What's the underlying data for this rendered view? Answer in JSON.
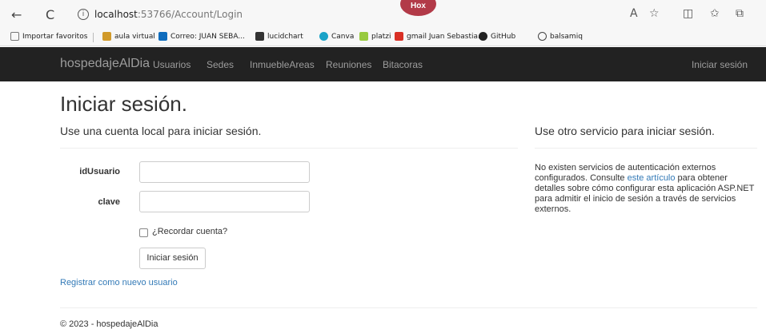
{
  "browser": {
    "back_glyph": "←",
    "reload_glyph": "C",
    "info_glyph": "i",
    "url_host": "localhost",
    "url_rest": ":53766/Account/Login",
    "profile_label": "Hox",
    "reader_glyph": "A",
    "star_glyph": "☆",
    "split_glyph": "◫",
    "favorites_glyph": "✩",
    "collections_glyph": "⧉",
    "bookmarks": [
      {
        "label": "Importar favoritos",
        "icon": "import-icon",
        "color": "#777777"
      },
      {
        "label": "aula virtual",
        "icon": "bookmark-icon",
        "color": "#d19a2a"
      },
      {
        "label": "Correo: JUAN SEBA...",
        "icon": "outlook-icon",
        "color": "#0f6cbd"
      },
      {
        "label": "lucidchart",
        "icon": "lucidchart-icon",
        "color": "#333333"
      },
      {
        "label": "Canva",
        "icon": "canva-icon",
        "color": "#1aa3c8"
      },
      {
        "label": "platzi",
        "icon": "platzi-icon",
        "color": "#98ca3f"
      },
      {
        "label": "gmail Juan Sebastia...",
        "icon": "gmail-icon",
        "color": "#d93025"
      },
      {
        "label": "GitHub",
        "icon": "github-icon",
        "color": "#222222"
      },
      {
        "label": "balsamiq",
        "icon": "balsamiq-icon",
        "color": "#444444"
      }
    ]
  },
  "navbar": {
    "brand": "hospedajeAlDia",
    "links": [
      "Usuarios",
      "Sedes",
      "InmuebleAreas",
      "Reuniones",
      "Bitacoras"
    ],
    "login": "Iniciar sesión"
  },
  "main": {
    "title": "Iniciar sesión.",
    "local_heading": "Use una cuenta local para iniciar sesión.",
    "external_heading": "Use otro servicio para iniciar sesión.",
    "fields": [
      {
        "label": "idUsuario",
        "value": ""
      },
      {
        "label": "clave",
        "value": ""
      }
    ],
    "remember_label": "¿Recordar cuenta?",
    "submit_label": "Iniciar sesión",
    "register_link": "Registrar como nuevo usuario",
    "external_text_before": "No existen servicios de autenticación externos configurados. Consulte ",
    "external_link": "este artículo",
    "external_text_after": " para obtener detalles sobre cómo configurar esta aplicación ASP.NET para admitir el inicio de sesión a través de servicios externos."
  },
  "footer": {
    "text": "© 2023 - hospedajeAlDia"
  },
  "colors": {
    "navbar_bg": "#222222",
    "navbar_text": "#9d9d9d",
    "link": "#337ab7"
  }
}
